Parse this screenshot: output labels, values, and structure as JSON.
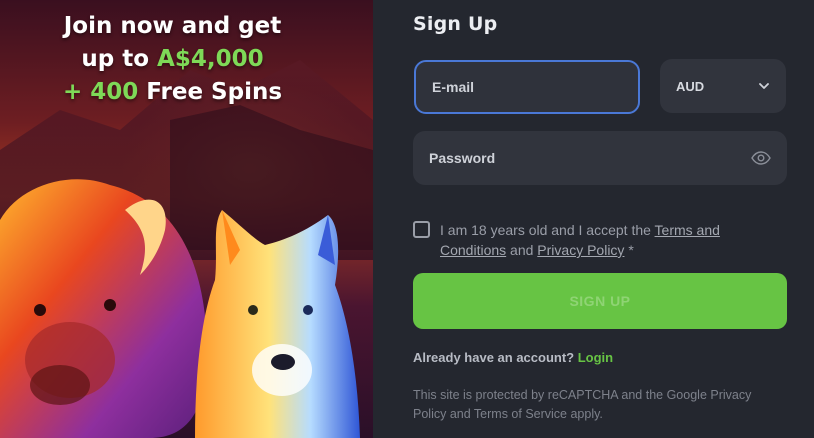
{
  "promo": {
    "line1": "Join now and get",
    "line2_prefix": "up to ",
    "line2_amount": "A$4,000",
    "line3_spins": "+ 400",
    "line3_suffix": " Free Spins",
    "accent_color": "#7ed957",
    "artwork": "buffalo-and-wolf-illustration"
  },
  "form": {
    "title": "Sign Up",
    "email_placeholder": "E-mail",
    "currency_value": "AUD",
    "password_placeholder": "Password",
    "terms_prefix": "I am 18 years old and I accept the ",
    "terms_link": "Terms and Conditions",
    "terms_and": " and ",
    "privacy_link": "Privacy Policy",
    "terms_required_mark": " *",
    "signup_label": "SIGN UP",
    "account_prompt": "Already have an account? ",
    "login_link": "Login",
    "recaptcha_notice": "This site is protected by reCAPTCHA and the Google Privacy Policy and Terms of Service apply.",
    "focus_color": "#4a78d6",
    "button_color": "#67c444"
  }
}
